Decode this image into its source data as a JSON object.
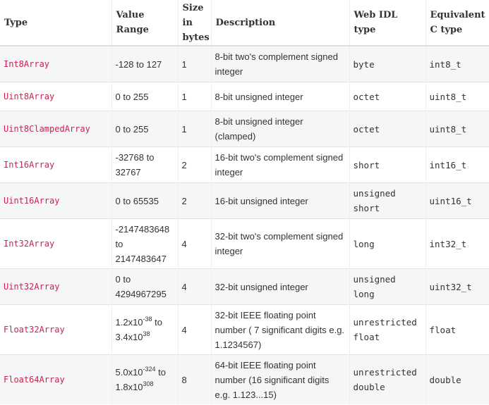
{
  "headers": {
    "type": "Type",
    "range": "Value Range",
    "size": "Size in bytes",
    "description": "Description",
    "webidl": "Web IDL type",
    "ctype": "Equivalent C type"
  },
  "rows": [
    {
      "type": "Int8Array",
      "range": "-128 to 127",
      "size": "1",
      "description": "8-bit two's complement signed integer",
      "webidl": "byte",
      "ctype": "int8_t"
    },
    {
      "type": "Uint8Array",
      "range": "0 to 255",
      "size": "1",
      "description": "8-bit unsigned integer",
      "webidl": "octet",
      "ctype": "uint8_t"
    },
    {
      "type": "Uint8ClampedArray",
      "range": "0 to 255",
      "size": "1",
      "description": "8-bit unsigned integer (clamped)",
      "webidl": "octet",
      "ctype": "uint8_t"
    },
    {
      "type": "Int16Array",
      "range": "-32768 to 32767",
      "size": "2",
      "description": "16-bit two's complement signed integer",
      "webidl": "short",
      "ctype": "int16_t"
    },
    {
      "type": "Uint16Array",
      "range": "0 to 65535",
      "size": "2",
      "description": "16-bit unsigned integer",
      "webidl": "unsigned short",
      "ctype": "uint16_t"
    },
    {
      "type": "Int32Array",
      "range": "-2147483648 to 2147483647",
      "size": "4",
      "description": "32-bit two's complement signed integer",
      "webidl": "long",
      "ctype": "int32_t"
    },
    {
      "type": "Uint32Array",
      "range": "0 to 4294967295",
      "size": "4",
      "description": "32-bit unsigned integer",
      "webidl": "unsigned long",
      "ctype": "uint32_t"
    },
    {
      "type": "Float32Array",
      "range_parts": {
        "m1": "1.2x10",
        "e1": "-38",
        "to": " to ",
        "m2": "3.4x10",
        "e2": "38"
      },
      "size": "4",
      "description": "32-bit IEEE floating point number ( 7 significant digits e.g. 1.1234567)",
      "webidl": "unrestricted float",
      "ctype": "float"
    },
    {
      "type": "Float64Array",
      "range_parts": {
        "m1": "5.0x10",
        "e1": "-324",
        "to": " to ",
        "m2": "1.8x10",
        "e2": "308"
      },
      "size": "8",
      "description": "64-bit IEEE floating point number (16 significant digits e.g. 1.123...15)",
      "webidl": "unrestricted double",
      "ctype": "double"
    }
  ]
}
